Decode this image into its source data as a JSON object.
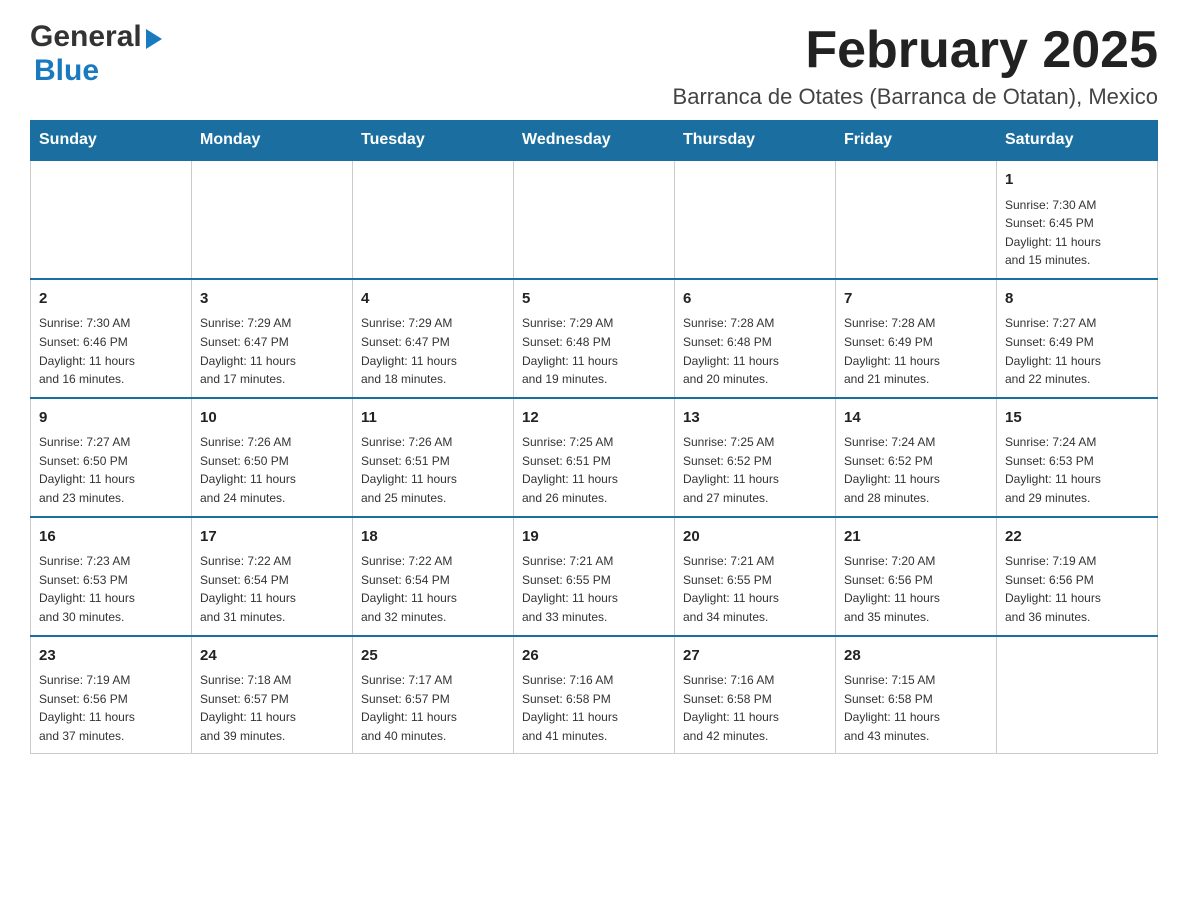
{
  "header": {
    "logo_general": "General",
    "logo_blue": "Blue",
    "month_title": "February 2025",
    "location": "Barranca de Otates (Barranca de Otatan), Mexico"
  },
  "days_of_week": [
    "Sunday",
    "Monday",
    "Tuesday",
    "Wednesday",
    "Thursday",
    "Friday",
    "Saturday"
  ],
  "weeks": [
    [
      {
        "day": "",
        "info": ""
      },
      {
        "day": "",
        "info": ""
      },
      {
        "day": "",
        "info": ""
      },
      {
        "day": "",
        "info": ""
      },
      {
        "day": "",
        "info": ""
      },
      {
        "day": "",
        "info": ""
      },
      {
        "day": "1",
        "info": "Sunrise: 7:30 AM\nSunset: 6:45 PM\nDaylight: 11 hours\nand 15 minutes."
      }
    ],
    [
      {
        "day": "2",
        "info": "Sunrise: 7:30 AM\nSunset: 6:46 PM\nDaylight: 11 hours\nand 16 minutes."
      },
      {
        "day": "3",
        "info": "Sunrise: 7:29 AM\nSunset: 6:47 PM\nDaylight: 11 hours\nand 17 minutes."
      },
      {
        "day": "4",
        "info": "Sunrise: 7:29 AM\nSunset: 6:47 PM\nDaylight: 11 hours\nand 18 minutes."
      },
      {
        "day": "5",
        "info": "Sunrise: 7:29 AM\nSunset: 6:48 PM\nDaylight: 11 hours\nand 19 minutes."
      },
      {
        "day": "6",
        "info": "Sunrise: 7:28 AM\nSunset: 6:48 PM\nDaylight: 11 hours\nand 20 minutes."
      },
      {
        "day": "7",
        "info": "Sunrise: 7:28 AM\nSunset: 6:49 PM\nDaylight: 11 hours\nand 21 minutes."
      },
      {
        "day": "8",
        "info": "Sunrise: 7:27 AM\nSunset: 6:49 PM\nDaylight: 11 hours\nand 22 minutes."
      }
    ],
    [
      {
        "day": "9",
        "info": "Sunrise: 7:27 AM\nSunset: 6:50 PM\nDaylight: 11 hours\nand 23 minutes."
      },
      {
        "day": "10",
        "info": "Sunrise: 7:26 AM\nSunset: 6:50 PM\nDaylight: 11 hours\nand 24 minutes."
      },
      {
        "day": "11",
        "info": "Sunrise: 7:26 AM\nSunset: 6:51 PM\nDaylight: 11 hours\nand 25 minutes."
      },
      {
        "day": "12",
        "info": "Sunrise: 7:25 AM\nSunset: 6:51 PM\nDaylight: 11 hours\nand 26 minutes."
      },
      {
        "day": "13",
        "info": "Sunrise: 7:25 AM\nSunset: 6:52 PM\nDaylight: 11 hours\nand 27 minutes."
      },
      {
        "day": "14",
        "info": "Sunrise: 7:24 AM\nSunset: 6:52 PM\nDaylight: 11 hours\nand 28 minutes."
      },
      {
        "day": "15",
        "info": "Sunrise: 7:24 AM\nSunset: 6:53 PM\nDaylight: 11 hours\nand 29 minutes."
      }
    ],
    [
      {
        "day": "16",
        "info": "Sunrise: 7:23 AM\nSunset: 6:53 PM\nDaylight: 11 hours\nand 30 minutes."
      },
      {
        "day": "17",
        "info": "Sunrise: 7:22 AM\nSunset: 6:54 PM\nDaylight: 11 hours\nand 31 minutes."
      },
      {
        "day": "18",
        "info": "Sunrise: 7:22 AM\nSunset: 6:54 PM\nDaylight: 11 hours\nand 32 minutes."
      },
      {
        "day": "19",
        "info": "Sunrise: 7:21 AM\nSunset: 6:55 PM\nDaylight: 11 hours\nand 33 minutes."
      },
      {
        "day": "20",
        "info": "Sunrise: 7:21 AM\nSunset: 6:55 PM\nDaylight: 11 hours\nand 34 minutes."
      },
      {
        "day": "21",
        "info": "Sunrise: 7:20 AM\nSunset: 6:56 PM\nDaylight: 11 hours\nand 35 minutes."
      },
      {
        "day": "22",
        "info": "Sunrise: 7:19 AM\nSunset: 6:56 PM\nDaylight: 11 hours\nand 36 minutes."
      }
    ],
    [
      {
        "day": "23",
        "info": "Sunrise: 7:19 AM\nSunset: 6:56 PM\nDaylight: 11 hours\nand 37 minutes."
      },
      {
        "day": "24",
        "info": "Sunrise: 7:18 AM\nSunset: 6:57 PM\nDaylight: 11 hours\nand 39 minutes."
      },
      {
        "day": "25",
        "info": "Sunrise: 7:17 AM\nSunset: 6:57 PM\nDaylight: 11 hours\nand 40 minutes."
      },
      {
        "day": "26",
        "info": "Sunrise: 7:16 AM\nSunset: 6:58 PM\nDaylight: 11 hours\nand 41 minutes."
      },
      {
        "day": "27",
        "info": "Sunrise: 7:16 AM\nSunset: 6:58 PM\nDaylight: 11 hours\nand 42 minutes."
      },
      {
        "day": "28",
        "info": "Sunrise: 7:15 AM\nSunset: 6:58 PM\nDaylight: 11 hours\nand 43 minutes."
      },
      {
        "day": "",
        "info": ""
      }
    ]
  ]
}
